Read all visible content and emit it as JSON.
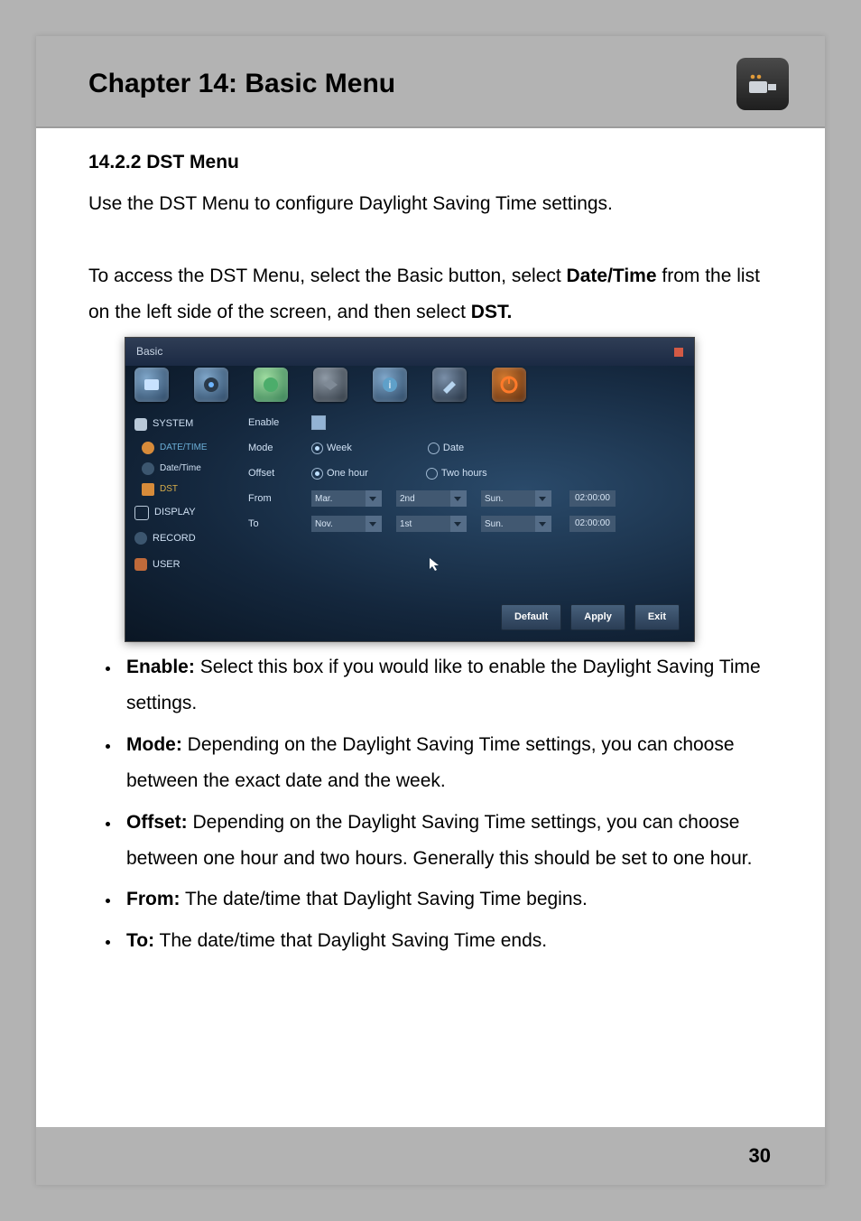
{
  "chapter_title": "Chapter 14: Basic Menu",
  "section_number": "14.2.2 DST Menu",
  "intro": "Use the DST Menu to configure Daylight Saving Time settings.",
  "access_pre": "To access the DST Menu, select the Basic button, select ",
  "access_bold1": "Date/Time",
  "access_mid": " from the list on the left side of the screen, and then select ",
  "access_bold2": "DST.",
  "figure": {
    "window_title": "Basic",
    "sidebar": {
      "system": "SYSTEM",
      "sub_datetime_header": "DATE/TIME",
      "sub_datetime": "Date/Time",
      "sub_dst": "DST",
      "display": "DISPLAY",
      "record": "RECORD",
      "user": "USER"
    },
    "form": {
      "enable": "Enable",
      "mode": "Mode",
      "mode_week": "Week",
      "mode_date": "Date",
      "offset": "Offset",
      "offset_one": "One hour",
      "offset_two": "Two hours",
      "from": "From",
      "from_month": "Mar.",
      "from_ord": "2nd",
      "from_day": "Sun.",
      "from_time": "02:00:00",
      "to": "To",
      "to_month": "Nov.",
      "to_ord": "1st",
      "to_day": "Sun.",
      "to_time": "02:00:00"
    },
    "buttons": {
      "default": "Default",
      "apply": "Apply",
      "exit": "Exit"
    }
  },
  "bullets": {
    "enable_label": "Enable:",
    "enable_text": " Select this box if you would like to enable the Daylight Saving Time settings.",
    "mode_label": "Mode:",
    "mode_text": " Depending on the Daylight Saving Time settings, you can choose between the exact date and the week.",
    "offset_label": "Offset:",
    "offset_text": " Depending on the Daylight Saving Time settings, you can choose between one hour and two hours. Generally this should be set to one hour.",
    "from_label": "From:",
    "from_text": " The date/time that Daylight Saving Time begins.",
    "to_label": "To:",
    "to_text": " The date/time that Daylight Saving Time ends."
  },
  "page_number": "30"
}
